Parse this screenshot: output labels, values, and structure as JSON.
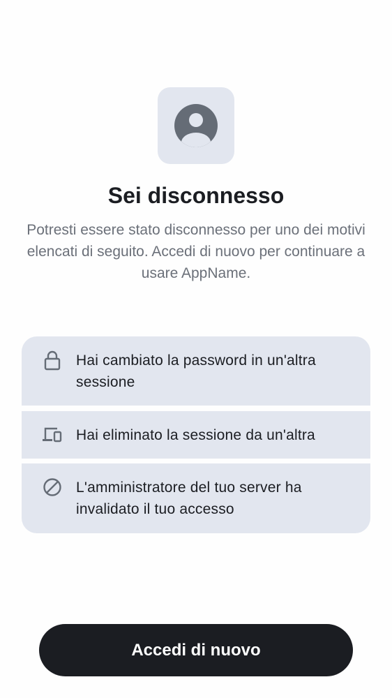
{
  "header": {
    "icon": "user-avatar-icon",
    "title": "Sei disconnesso",
    "description": "Potresti essere stato disconnesso per uno dei motivi elencati di seguito. Accedi di nuovo per continuare a usare AppName."
  },
  "reasons": [
    {
      "icon": "lock-icon",
      "text": "Hai cambiato la password in un'altra sessione"
    },
    {
      "icon": "devices-icon",
      "text": "Hai eliminato la sessione da un'altra"
    },
    {
      "icon": "block-icon",
      "text": "L'amministratore del tuo server ha invalidato il tuo accesso"
    }
  ],
  "action": {
    "label": "Accedi di nuovo"
  },
  "colors": {
    "background": "#fefefe",
    "tile": "#e2e6ef",
    "icon": "#656c76",
    "text": "#1b1d22",
    "secondary_text": "#6b7079",
    "button": "#1b1d22",
    "button_text": "#ffffff"
  }
}
